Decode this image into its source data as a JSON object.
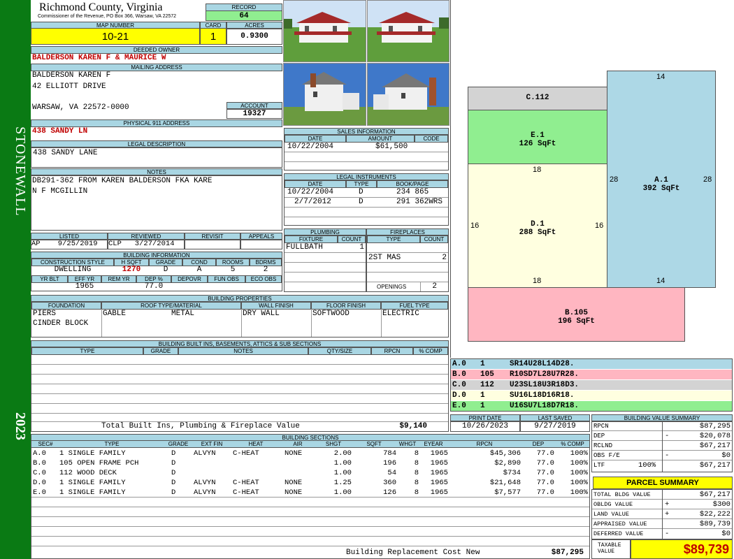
{
  "sidebar": {
    "district": "STONEWALL",
    "year": "2023",
    "color": "#0a7a14"
  },
  "header": {
    "county": "Richmond County, Virginia",
    "commissioner": "Commissioner of the Revenue, PO Box 366, Warsaw, VA 22572",
    "record_label": "RECORD",
    "record": "64",
    "map_label": "MAP NUMBER",
    "map": "10-21",
    "card_label": "CARD",
    "card": "1",
    "acres_label": "ACRES",
    "acres": "0.9300"
  },
  "owner": {
    "deeded_label": "DEEDED OWNER",
    "deeded": "BALDERSON KAREN F & MAURICE W",
    "mailing_label": "MAILING ADDRESS",
    "line1": "BALDERSON KAREN F",
    "line2": "42 ELLIOTT DRIVE",
    "line3": "WARSAW, VA 22572-0000",
    "account_label": "ACCOUNT",
    "account": "19327",
    "physical_label": "PHYSICAL 911 ADDRESS",
    "physical": "438 SANDY LN",
    "legal_label": "LEGAL DESCRIPTION",
    "legal": "438 SANDY LANE",
    "notes_label": "NOTES",
    "notes1": "DB291-362 FROM KAREN BALDERSON FKA KARE",
    "notes2": "N F MCGILLIN"
  },
  "status": {
    "listed_label": "LISTED",
    "listed": "AP    9/25/2019",
    "reviewed_label": "REVIEWED",
    "reviewed": "CLP   3/27/2014",
    "revisit_label": "REVISIT",
    "appeals_label": "APPEALS"
  },
  "building_info": {
    "title": "BUILDING INFORMATION",
    "h": [
      "CONSTRUCTION STYLE",
      "H SQFT",
      "GRADE",
      "COND",
      "ROOMS",
      "BDRMS"
    ],
    "v": [
      "DWELLING",
      "1270",
      "D",
      "A",
      "5",
      "2"
    ],
    "h2": [
      "YR BLT",
      "EFF YR",
      "REM YR",
      "DEP %",
      "DEPOVR",
      "FUN OBS",
      "ECO OBS"
    ],
    "v2": [
      "",
      "1965",
      "",
      "77.0",
      "",
      "",
      ""
    ]
  },
  "props": {
    "title": "BUILDING PROPERTIES",
    "h": [
      "FOUNDATION",
      "ROOF TYPE/MATERIAL",
      "WALL FINISH",
      "FLOOR FINISH",
      "FUEL TYPE"
    ],
    "foundation1": "PIERS",
    "foundation2": "CINDER BLOCK",
    "roof_type": "GABLE",
    "roof_mat": "METAL",
    "wall": "DRY WALL",
    "floor": "SOFTWOOD",
    "fuel": "ELECTRIC"
  },
  "builtins": {
    "title": "BUILDING BUILT INS, BASEMENTS, ATTICS & SUB SECTIONS",
    "h": [
      "TYPE",
      "GRADE",
      "NOTES",
      "QTY/SIZE",
      "RPCN",
      "% COMP"
    ],
    "total_label": "Total Built Ins, Plumbing & Fireplace Value",
    "total": "$9,140"
  },
  "sales": {
    "title": "SALES INFORMATION",
    "h": [
      "DATE",
      "AMOUNT",
      "CODE"
    ],
    "rows": [
      [
        "10/22/2004",
        "$61,500",
        ""
      ]
    ]
  },
  "legal_inst": {
    "title": "LEGAL INSTRUMENTS",
    "h": [
      "DATE",
      "TYPE",
      "BOOK/PAGE"
    ],
    "rows": [
      [
        "10/22/2004",
        "D",
        "234 865"
      ],
      [
        "2/7/2012",
        "D",
        "291 362WRS"
      ]
    ]
  },
  "plumbing": {
    "title": "PLUMBING",
    "h": [
      "FIXTURE",
      "COUNT"
    ],
    "fixture": "FULLBATH",
    "count": "1"
  },
  "fireplaces": {
    "title": "FIREPLACES",
    "h": [
      "TYPE",
      "COUNT"
    ],
    "type": "2ST MAS",
    "count": "2",
    "openings_label": "OPENINGS",
    "openings": "2"
  },
  "sketch": {
    "blocks": [
      {
        "id": "C.112",
        "area": ""
      },
      {
        "id": "E.1",
        "area": "126 SqFt"
      },
      {
        "id": "D.1",
        "area": "288 SqFt"
      },
      {
        "id": "A.1",
        "area": "392 SqFt"
      },
      {
        "id": "B.105",
        "area": "196 SqFt"
      }
    ],
    "dims": [
      "14",
      "28",
      "28",
      "18",
      "16",
      "16",
      "18",
      "14"
    ]
  },
  "legend": [
    {
      "a": "A.0",
      "b": "1",
      "c": "SR14U28L14D28.",
      "color": "#add8e6"
    },
    {
      "a": "B.0",
      "b": "105",
      "c": "R10SD7L28U7R28.",
      "color": "#ffb6c1"
    },
    {
      "a": "C.0",
      "b": "112",
      "c": "U23SL18U3R18D3.",
      "color": "#d3d3d3"
    },
    {
      "a": "D.0",
      "b": "1",
      "c": "SU16L18D16R18.",
      "color": "#ffffe0"
    },
    {
      "a": "E.0",
      "b": "1",
      "c": "U16SU7L18D7R18.",
      "color": "#90ee90"
    }
  ],
  "dates": {
    "print_label": "PRINT DATE",
    "print": "10/26/2023",
    "saved_label": "LAST SAVED",
    "saved": "9/27/2019"
  },
  "bsections": {
    "title": "BUILDING SECTIONS",
    "h": [
      "SEC#",
      "TYPE",
      "GRADE",
      "EXT FIN",
      "HEAT",
      "AIR",
      "SHGT",
      "SQFT",
      "WHGT",
      "EYEAR",
      "RPCN",
      "DEP",
      "% COMP"
    ],
    "rows": [
      [
        "A.0",
        "1 SINGLE FAMILY",
        "D",
        "ALVYN",
        "C-HEAT",
        "NONE",
        "2.00",
        "784",
        "8",
        "1965",
        "$45,306",
        "77.0",
        "100%"
      ],
      [
        "B.0",
        "105 OPEN FRAME PCH",
        "D",
        "",
        "",
        "",
        "1.00",
        "196",
        "8",
        "1965",
        "$2,890",
        "77.0",
        "100%"
      ],
      [
        "C.0",
        "112 WOOD DECK",
        "D",
        "",
        "",
        "",
        "1.00",
        "54",
        "8",
        "1965",
        "$734",
        "77.0",
        "100%"
      ],
      [
        "D.0",
        "1 SINGLE FAMILY",
        "D",
        "ALVYN",
        "C-HEAT",
        "NONE",
        "1.25",
        "360",
        "8",
        "1965",
        "$21,648",
        "77.0",
        "100%"
      ],
      [
        "E.0",
        "1 SINGLE FAMILY",
        "D",
        "ALVYN",
        "C-HEAT",
        "NONE",
        "1.00",
        "126",
        "8",
        "1965",
        "$7,577",
        "77.0",
        "100%"
      ]
    ],
    "total_label": "Building Replacement Cost New",
    "total": "$87,295"
  },
  "bvs": {
    "title": "BUILDING VALUE SUMMARY",
    "rows": [
      {
        "l": "RPCN",
        "s": "",
        "v": "$87,295"
      },
      {
        "l": "DEP",
        "s": "-",
        "v": "$20,078"
      },
      {
        "l": "RCLND",
        "s": "",
        "v": "$67,217"
      },
      {
        "l": "OBS F/E",
        "s": "-",
        "v": "$0"
      },
      {
        "l": "LTF",
        "p": "100%",
        "s": "",
        "v": "$67,217"
      }
    ]
  },
  "parcel": {
    "title": "PARCEL SUMMARY",
    "rows": [
      {
        "l": "TOTAL BLDG VALUE",
        "s": "",
        "v": "$67,217"
      },
      {
        "l": "OBLDG VALUE",
        "s": "+",
        "v": "$300"
      },
      {
        "l": "LAND VALUE",
        "s": "+",
        "v": "$22,222"
      },
      {
        "l": "APPRAISED VALUE",
        "s": "",
        "v": "$89,739"
      },
      {
        "l": "DEFERRED VALUE",
        "s": "-",
        "v": "$0"
      }
    ],
    "taxable_label1": "TAXABLE",
    "taxable_label2": "VALUE",
    "taxable": "$89,739",
    "color": "#ffff00"
  }
}
